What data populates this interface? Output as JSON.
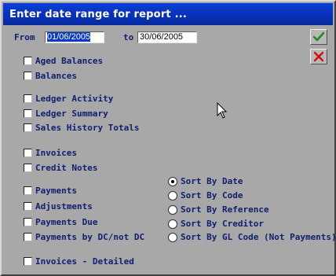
{
  "window": {
    "title": "Enter date range for report ..."
  },
  "date_range": {
    "from_label": "From",
    "from_value": "01/06/2005",
    "to_label": "to",
    "to_value": "30/06/2005"
  },
  "buttons": {
    "ok_icon": "check-icon",
    "cancel_icon": "x-icon",
    "ok_color": "#1f8a1f",
    "cancel_color": "#d01010"
  },
  "checkboxes": {
    "aged_balances": "Aged Balances",
    "balances": "Balances",
    "ledger_activity": "Ledger Activity",
    "ledger_summary": "Ledger Summary",
    "sales_history_totals": "Sales History Totals",
    "invoices": "Invoices",
    "credit_notes": "Credit Notes",
    "payments": "Payments",
    "adjustments": "Adjustments",
    "payments_due": "Payments Due",
    "payments_by_dc": "Payments by DC/not DC",
    "invoices_detailed": "Invoices - Detailed"
  },
  "sort": {
    "selected": "Sort By Date",
    "by_date": "Sort By Date",
    "by_code": "Sort By Code",
    "by_reference": "Sort By Reference",
    "by_creditor": "Sort By Creditor",
    "by_gl_code": "Sort By GL Code (Not Payments)"
  }
}
